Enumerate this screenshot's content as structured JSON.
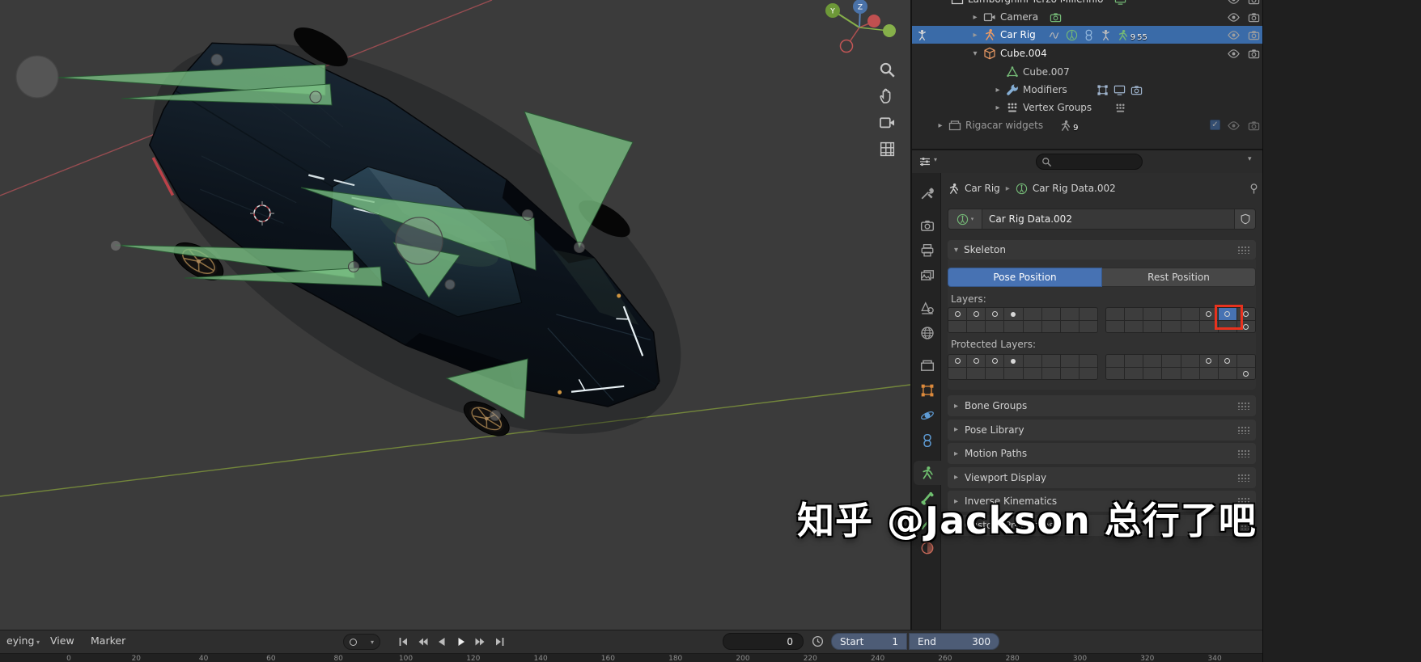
{
  "watermark": "知乎 @Jackson 总行了吧",
  "colors": {
    "accent": "#4772b3",
    "selection_blue": "#3a6ba8",
    "annotation_red": "#e8321e",
    "bone_green": "#7bc184"
  },
  "viewport": {
    "tools": [
      "zoom-icon",
      "hand-icon",
      "camera-view-icon",
      "grid-icon"
    ],
    "gizmo_axis_labels": [
      "Y",
      "Z"
    ]
  },
  "outliner": {
    "rows": [
      {
        "label": "Lamborghini Terzo Millennio",
        "arrow": "",
        "icon": "collection-icon",
        "icon_color": "#cfcfcf",
        "label_color": "#d9d9d9",
        "trail": [
          {
            "icon": "screen-icon",
            "color": "#74b876"
          }
        ],
        "trail_gap": 8,
        "right": [
          "eye",
          "camera"
        ]
      },
      {
        "label": "Camera",
        "arrow": "right",
        "icon": "camera-object-icon",
        "icon_color": "#ababab",
        "trail": [
          {
            "icon": "camera-data-icon",
            "color": "#74b876"
          }
        ],
        "trail_gap": 8,
        "right": [
          "eye",
          "camera"
        ]
      },
      {
        "label": "Car Rig",
        "arrow": "right",
        "icon": "armature-icon",
        "icon_color": "#ea9a64",
        "label_color": "#ffffff",
        "selected": true,
        "mode_icon": true,
        "trail": [
          {
            "icon": "driver-icon",
            "color": "#b5b5b5"
          },
          {
            "icon": "armature-data-icon",
            "color": "#74b876"
          },
          {
            "icon": "constraint-icon",
            "color": "#93b7dc"
          },
          {
            "icon": "pose-icon",
            "color": "#bdbdbd"
          },
          {
            "icon": "armature-icon",
            "color": "#74b876",
            "badge": "9"
          },
          {
            "badge": "55"
          }
        ],
        "trail_gap": 10,
        "right": [
          "eye",
          "camera"
        ]
      },
      {
        "label": "Cube.004",
        "arrow": "down",
        "icon": "cube-icon",
        "icon_color": "#ea9a64",
        "label_color": "#efefef",
        "right": [
          "eye",
          "camera"
        ]
      },
      {
        "label": "Cube.007",
        "arrow": "",
        "icon": "mesh-icon",
        "icon_color": "#74b876",
        "right": []
      },
      {
        "label": "Modifiers",
        "arrow": "right",
        "icon": "wrench-icon",
        "icon_color": "#85aed4",
        "trail": [
          {
            "icon": "editmode-icon",
            "color": "#9fb4cd"
          },
          {
            "icon": "screen-icon",
            "color": "#9fb4cd"
          },
          {
            "icon": "camera-data-icon",
            "color": "#9fb4cd"
          }
        ],
        "trail_gap": 30,
        "right": []
      },
      {
        "label": "Vertex Groups",
        "arrow": "right",
        "icon": "vgroup-icon",
        "icon_color": "#b5b5b5",
        "trail": [
          {
            "icon": "vgroup-icon",
            "color": "#9a9a9a"
          }
        ],
        "trail_gap": 22,
        "right": []
      },
      {
        "label": "Rigacar widgets",
        "arrow": "right",
        "icon": "collection-icon",
        "icon_color": "#909090",
        "label_color": "#9a9a9a",
        "dim": true,
        "trail": [
          {
            "icon": "armature-icon",
            "color": "#9a9a9a",
            "badge": "9"
          }
        ],
        "trail_gap": 14,
        "right": [
          "checkbox",
          "eye",
          "camera"
        ]
      }
    ]
  },
  "properties": {
    "header": {
      "search_placeholder": ""
    },
    "breadcrumb": {
      "object": "Car Rig",
      "data": "Car Rig Data.002"
    },
    "name_field": {
      "value": "Car Rig Data.002"
    },
    "skeleton": {
      "title": "Skeleton",
      "pose_button": "Pose Position",
      "rest_button": "Rest Position",
      "layers_label": "Layers:",
      "protected_label": "Protected Layers:",
      "layers": {
        "row1": [
          "circle",
          "circle",
          "circle",
          "dot",
          "",
          "",
          "",
          "",
          "",
          "",
          "",
          "",
          "",
          "circle",
          "active",
          "circle"
        ],
        "row2": [
          "",
          "",
          "",
          "",
          "",
          "",
          "",
          "",
          "",
          "",
          "",
          "",
          "",
          "",
          "",
          "circle"
        ]
      },
      "protected_layers": {
        "row1": [
          "circle",
          "circle",
          "circle",
          "dot",
          "",
          "",
          "",
          "",
          "",
          "",
          "",
          "",
          "",
          "circle",
          "circle",
          ""
        ],
        "row2": [
          "",
          "",
          "",
          "",
          "",
          "",
          "",
          "",
          "",
          "",
          "",
          "",
          "",
          "",
          "",
          "circle"
        ]
      }
    },
    "panels": [
      "Bone Groups",
      "Pose Library",
      "Motion Paths",
      "Viewport Display",
      "Inverse Kinematics",
      "Custom Properties"
    ],
    "tabs": [
      {
        "name": "tool",
        "icon": "tool-icon",
        "color": "#a0a0a0"
      },
      {
        "name": "render",
        "icon": "camera-data-icon",
        "color": "#a0a0a0"
      },
      {
        "name": "output",
        "icon": "printer-icon",
        "color": "#a0a0a0"
      },
      {
        "name": "view-layer",
        "icon": "photos-icon",
        "color": "#a0a0a0"
      },
      {
        "name": "scene",
        "icon": "scene-icon",
        "color": "#a0a0a0"
      },
      {
        "name": "world",
        "icon": "world-icon",
        "color": "#a0a0a0"
      },
      {
        "name": "collection",
        "icon": "collection-icon",
        "color": "#a0a0a0"
      },
      {
        "name": "object",
        "icon": "object-icon",
        "color": "#dd8a3c"
      },
      {
        "name": "physics",
        "icon": "physics-icon",
        "color": "#5e9bd4"
      },
      {
        "name": "object-constraints",
        "icon": "constraint-icon",
        "color": "#5e9bd4"
      },
      {
        "name": "object-data",
        "icon": "armature-icon",
        "color": "#6fbf6f",
        "active": true
      },
      {
        "name": "bone",
        "icon": "bone-icon",
        "color": "#6fbf6f"
      },
      {
        "name": "bone-constraints",
        "icon": "bone-constraint-icon",
        "color": "#6fbf6f"
      },
      {
        "name": "material",
        "icon": "material-icon",
        "color": "#c86a5a"
      }
    ]
  },
  "timeline": {
    "menus": [
      "eying",
      "View",
      "Marker"
    ],
    "transport": [
      "jump-start",
      "prev-keyframe",
      "play-reverse",
      "play",
      "next-keyframe",
      "jump-end"
    ],
    "frame_current": "0",
    "start_label": "Start",
    "start_value": "1",
    "end_label": "End",
    "end_value": "300",
    "ruler_frames": [
      0,
      20,
      40,
      60,
      80,
      100,
      120,
      140,
      160,
      180,
      200,
      220,
      240,
      260,
      280,
      300,
      320,
      340
    ]
  }
}
